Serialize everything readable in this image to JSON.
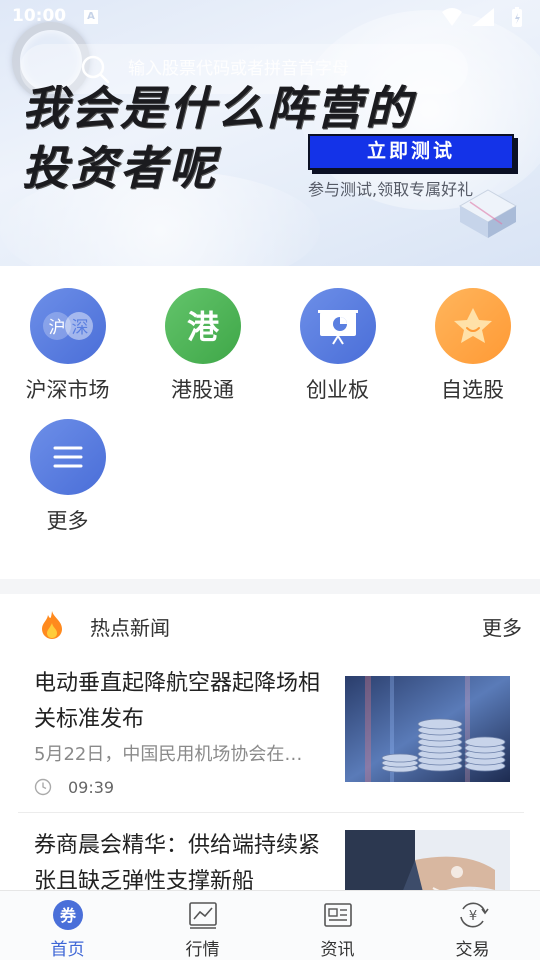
{
  "status_bar": {
    "time": "10:00",
    "notification": "A"
  },
  "search": {
    "placeholder": "输入股票代码或者拼音首字母"
  },
  "banner": {
    "headline_line1": "我会是什么阵营的",
    "headline_line2": "投资者呢",
    "cta_label": "立即测试",
    "cta_subtitle": "参与测试,领取专属好礼"
  },
  "quick_entries": [
    {
      "label": "沪深市场",
      "icon": "hushen-icon",
      "glyph_left": "沪",
      "glyph_right": "深",
      "color": "#5a7fe0"
    },
    {
      "label": "港股通",
      "icon": "hk-icon",
      "glyph": "港",
      "color": "#4cb556"
    },
    {
      "label": "创业板",
      "icon": "chart-board-icon",
      "color": "#5a7fe0"
    },
    {
      "label": "自选股",
      "icon": "star-icon",
      "color": "#ffa640"
    },
    {
      "label": "更多",
      "icon": "menu-icon",
      "color": "#5a7fe0"
    }
  ],
  "news": {
    "section_title": "热点新闻",
    "more_label": "更多",
    "articles": [
      {
        "title": "电动垂直起降航空器起降场相关标准发布",
        "summary": "5月22日，中国民用机场协会在…",
        "time": "09:39"
      },
      {
        "title": "券商晨会精华：供给端持续紧张且缺乏弹性支撑新船",
        "summary": "",
        "time": ""
      }
    ]
  },
  "bottom_nav": [
    {
      "label": "首页",
      "icon": "home-icon",
      "glyph": "券",
      "active": true
    },
    {
      "label": "行情",
      "icon": "market-icon",
      "active": false
    },
    {
      "label": "资讯",
      "icon": "news-icon",
      "active": false
    },
    {
      "label": "交易",
      "icon": "trade-icon",
      "active": false
    }
  ],
  "colors": {
    "accent": "#3e66d6",
    "cta_blue": "#1433e8",
    "green": "#4cb556",
    "orange": "#ffa640"
  }
}
